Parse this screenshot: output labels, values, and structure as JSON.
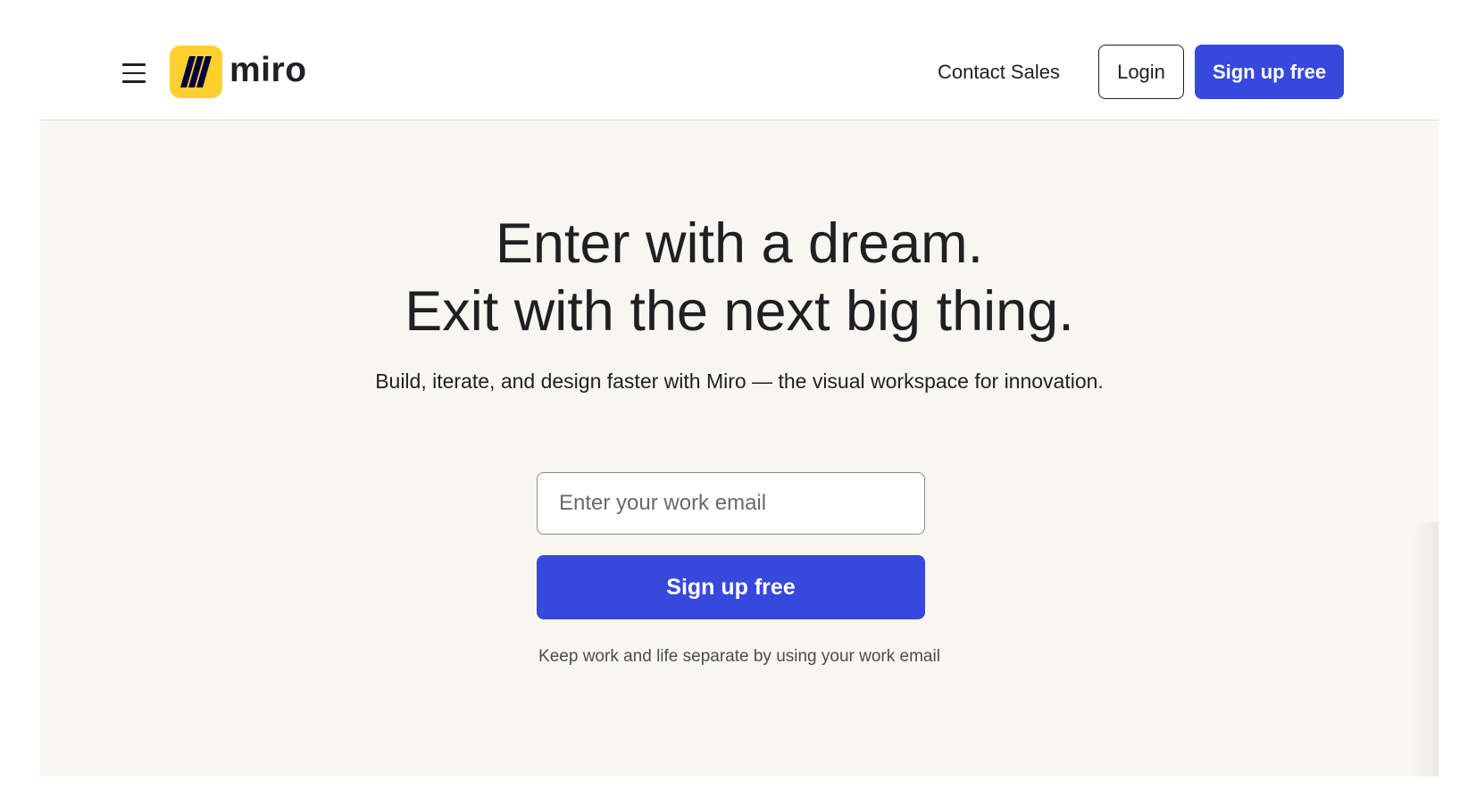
{
  "header": {
    "brand": {
      "name": "miro",
      "logo_icon": "miro-logo-icon",
      "logo_color": "#ffd02f"
    },
    "menu_icon": "hamburger-menu-icon",
    "nav": {
      "contact_sales": "Contact Sales",
      "login": "Login",
      "signup": "Sign up free"
    }
  },
  "hero": {
    "title_line1": "Enter with a dream.",
    "title_line2": "Exit with the next big thing.",
    "subtitle": "Build, iterate, and design faster with Miro — the visual workspace for innovation.",
    "email_placeholder": "Enter your work email",
    "email_value": "",
    "signup_label": "Sign up free",
    "note": "Keep work and life separate by using your work email"
  },
  "colors": {
    "primary": "#3748dd",
    "brand_yellow": "#ffd02f",
    "hero_background": "#f8f6f1",
    "text": "#1f1f24"
  }
}
